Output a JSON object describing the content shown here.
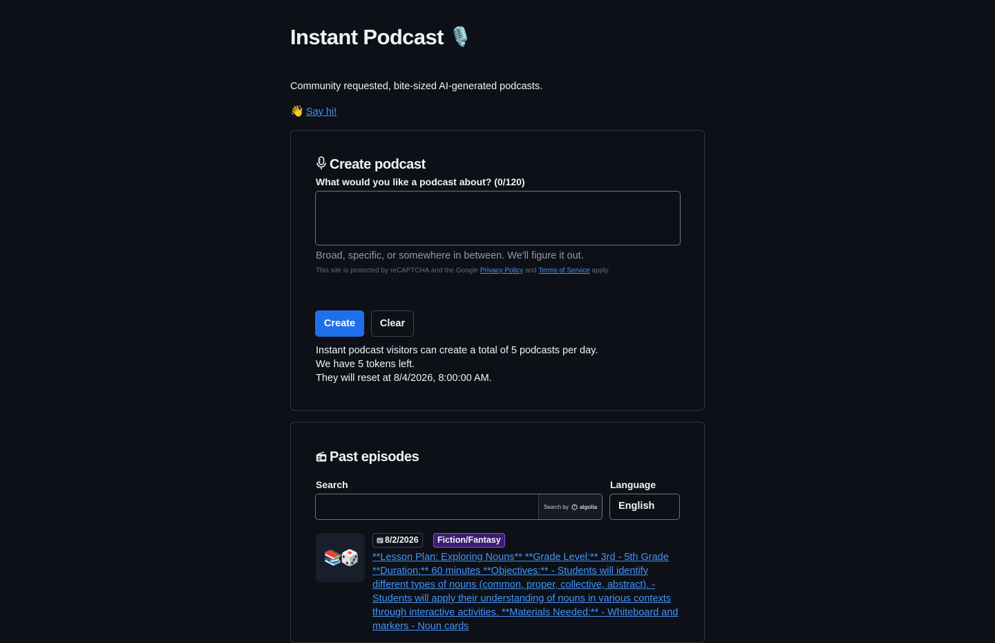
{
  "app": {
    "title": "Instant Podcast",
    "title_emoji": "🎙️",
    "tagline": "Community requested, bite-sized AI-generated podcasts.",
    "say_hi": {
      "emoji": "👋",
      "label": "Say hi!"
    }
  },
  "create": {
    "heading": "Create podcast",
    "heading_icon": "microphone-icon",
    "field_label": "What would you like a podcast about? (0/120)",
    "field_value": "",
    "hint": "Broad, specific, or somewhere in between. We'll figure it out.",
    "recaptcha": {
      "prefix": "This site is protected by reCAPTCHA and the Google",
      "privacy_label": "Privacy Policy",
      "and": "and",
      "terms_label": "Terms of Service",
      "suffix": "apply."
    },
    "create_button": "Create",
    "clear_button": "Clear",
    "quota_lines": [
      "Instant podcast visitors can create a total of 5 podcasts per day.",
      "We have 5 tokens left.",
      "They will reset at 8/4/2026, 8:00:00 AM."
    ]
  },
  "past": {
    "heading": "Past episodes",
    "heading_icon": "radio-icon",
    "search_label": "Search",
    "search_value": "",
    "search_by_prefix": "Search by",
    "search_by_brand": "algolia",
    "language_label": "Language",
    "language_value": "English",
    "episodes": [
      {
        "thumb": "📚🎲",
        "date": "8/2/2026",
        "genre": "Fiction/Fantasy",
        "description": "**Lesson Plan: Exploring Nouns** **Grade Level:** 3rd - 5th Grade **Duration:** 60 minutes **Objectives:** - Students will identify different types of nouns (common, proper, collective, abstract). - Students will apply their understanding of nouns in various contexts through interactive activities. **Materials Needed:** - Whiteboard and markers - Noun cards"
      }
    ]
  },
  "colors": {
    "background": "#0d1117",
    "border": "#30363d",
    "accent": "#1f6feb",
    "link": "#4493f8",
    "genre_badge": "#3c1e70"
  }
}
